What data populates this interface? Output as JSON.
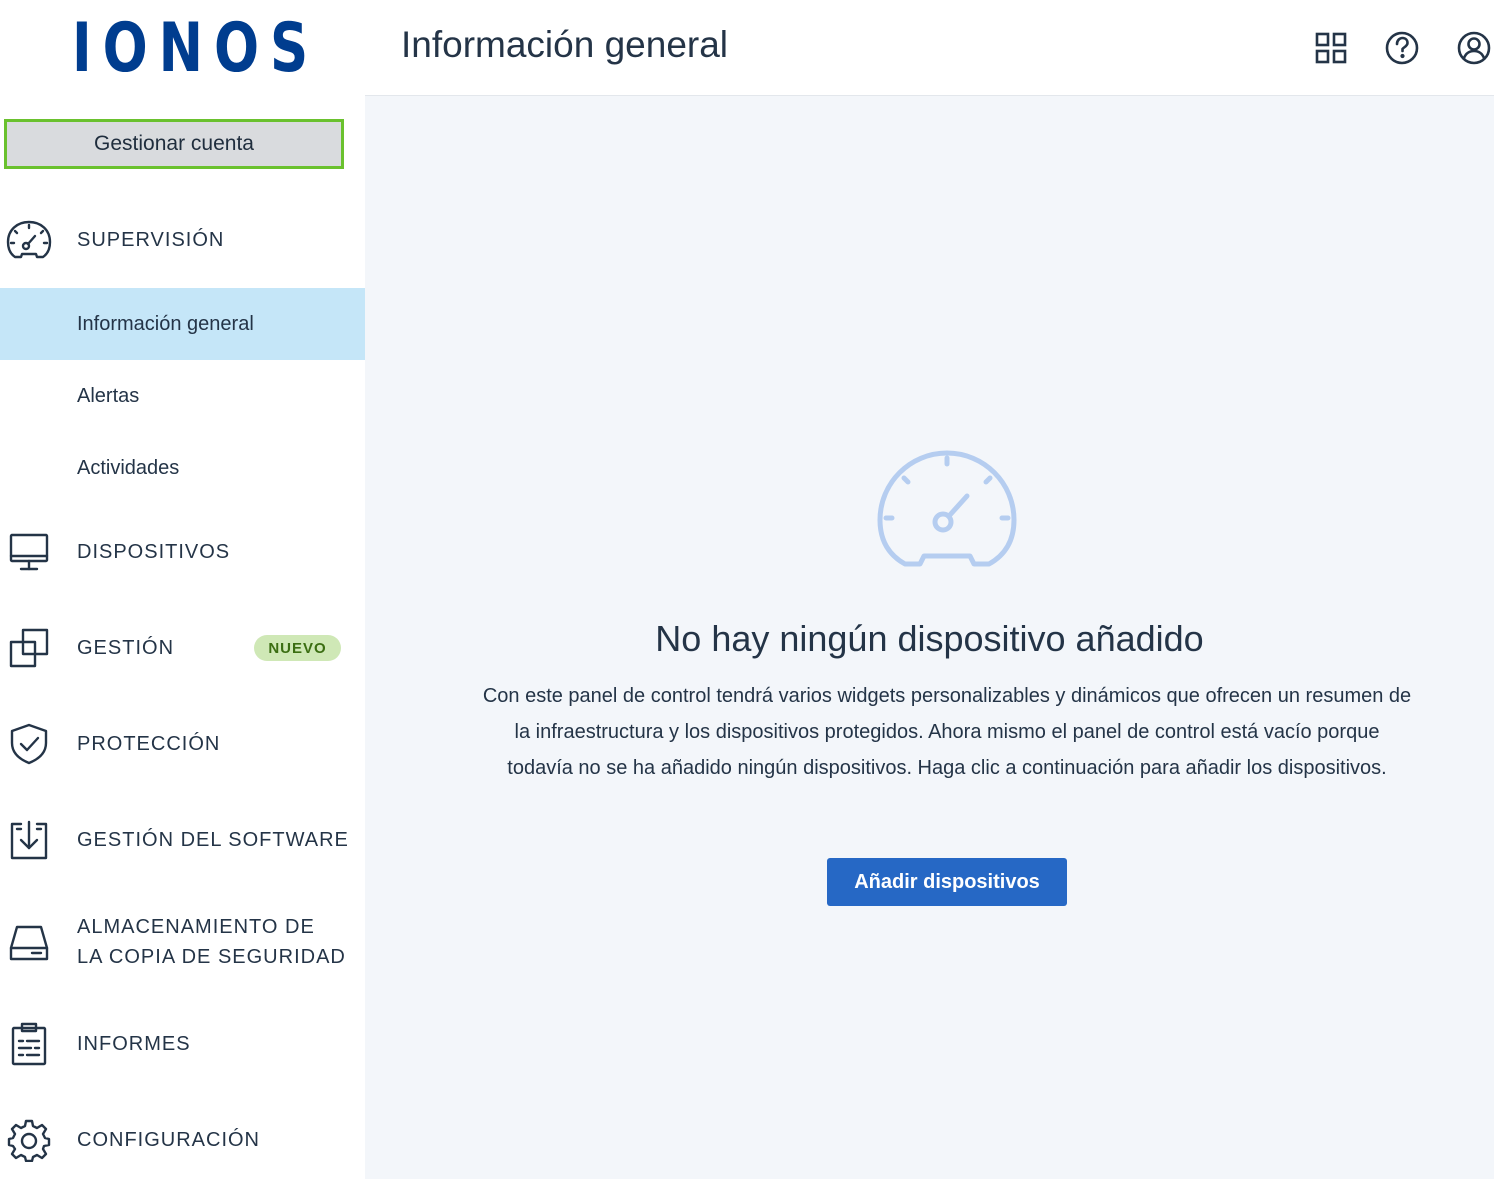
{
  "brand": {
    "logo_text": "IONOS",
    "logo_color": "#003d8f"
  },
  "sidebar": {
    "manage_account_label": "Gestionar cuenta",
    "sections": [
      {
        "label": "SUPERVISIÓN",
        "icon": "speedometer-icon"
      },
      {
        "label": "DISPOSITIVOS",
        "icon": "monitor-icon"
      },
      {
        "label": "GESTIÓN",
        "icon": "copy-windows-icon",
        "badge": "NUEVO"
      },
      {
        "label": "PROTECCIÓN",
        "icon": "shield-check-icon"
      },
      {
        "label": "GESTIÓN DEL SOFTWARE",
        "icon": "download-box-icon"
      },
      {
        "label_line1": "ALMACENAMIENTO DE",
        "label_line2": "LA COPIA DE SEGURIDAD",
        "icon": "hard-drive-icon"
      },
      {
        "label": "INFORMES",
        "icon": "clipboard-report-icon"
      },
      {
        "label": "CONFIGURACIÓN",
        "icon": "gear-icon"
      }
    ],
    "supervision_items": [
      {
        "label": "Información general",
        "active": true
      },
      {
        "label": "Alertas",
        "active": false
      },
      {
        "label": "Actividades",
        "active": false
      }
    ],
    "active_color": "#c5e6f8",
    "badge_color": "#cfe8b6"
  },
  "header": {
    "title": "Información general",
    "icons": [
      "apps-grid-icon",
      "help-icon",
      "user-account-icon"
    ]
  },
  "main": {
    "empty_icon": "speedometer-icon",
    "empty_title": "No hay ningún dispositivo añadido",
    "empty_description": "Con este panel de control tendrá varios widgets personalizables y dinámicos que ofrecen un resumen de la infraestructura y los dispositivos protegidos. Ahora mismo el panel de control está vacío porque todavía no se ha añadido ningún dispositivos. Haga clic a continuación para añadir los dispositivos.",
    "add_devices_label": "Añadir dispositivos",
    "accent_color": "#2668c5",
    "background_color": "#f3f6fa"
  }
}
